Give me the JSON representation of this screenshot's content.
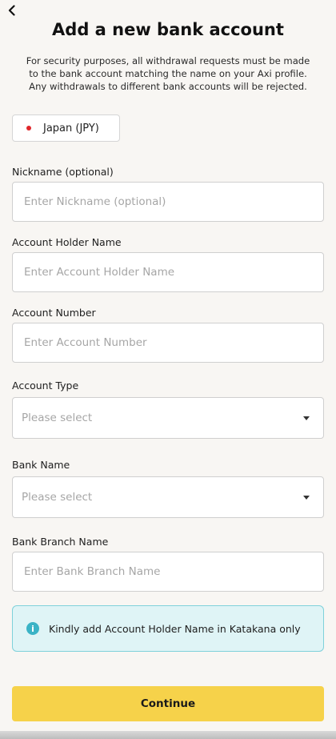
{
  "header": {
    "back_icon": "chevron-left-icon",
    "title": "Add a new bank account"
  },
  "notice": {
    "line1": "For security purposes, all withdrawal requests must be made",
    "line2": "to the bank account matching the name on your Axi profile.",
    "line3": "Any withdrawals to different bank accounts will be rejected."
  },
  "country": {
    "label": "Japan (JPY)",
    "flag_color": "#e0262b"
  },
  "form": {
    "nickname": {
      "label": "Nickname (optional)",
      "placeholder": "Enter Nickname (optional)"
    },
    "holder_name": {
      "label": "Account Holder Name",
      "placeholder": "Enter Account Holder Name"
    },
    "account_number": {
      "label": "Account Number",
      "placeholder": "Enter Account Number"
    },
    "account_type": {
      "label": "Account Type",
      "placeholder": "Please select"
    },
    "bank_name": {
      "label": "Bank Name",
      "placeholder": "Please select"
    },
    "branch_name": {
      "label": "Bank Branch Name",
      "placeholder": "Enter Bank Branch Name"
    }
  },
  "info": {
    "icon": "info-icon",
    "text": "Kindly add Account Holder Name in Katakana only",
    "accent": "#3ab3c6"
  },
  "actions": {
    "continue_label": "Continue",
    "continue_color": "#f6d24a"
  }
}
